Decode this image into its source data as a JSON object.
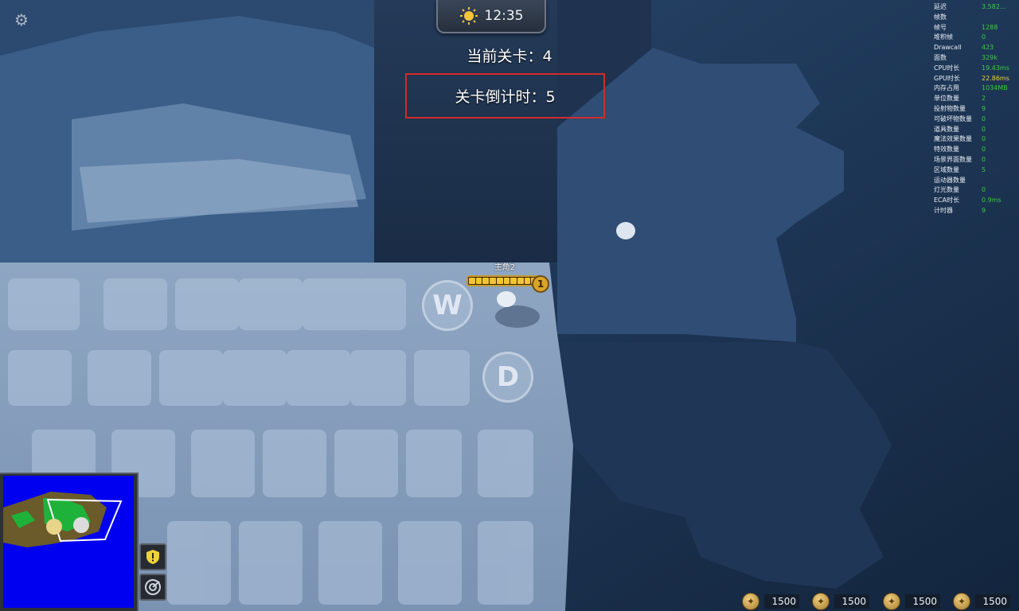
{
  "hud": {
    "clock_time": "12:35",
    "level_label": "当前关卡：4",
    "countdown_label": "关卡倒计时：5"
  },
  "player": {
    "name": "主角2",
    "level_badge": "1",
    "health_fraction": 1.0
  },
  "key_hints": {
    "w": "W",
    "d": "D"
  },
  "stats": [
    {
      "name": "延迟",
      "value": "3.582..."
    },
    {
      "name": "帧数",
      "value": ""
    },
    {
      "name": "帧号",
      "value": "1288"
    },
    {
      "name": "堆积帧",
      "value": "0"
    },
    {
      "name": "Drawcall",
      "value": "423"
    },
    {
      "name": "面数",
      "value": "329k"
    },
    {
      "name": "CPU时长",
      "value": "19.43ms"
    },
    {
      "name": "GPU时长",
      "value": "22.86ms"
    },
    {
      "name": "内存占用",
      "value": "1034MB"
    },
    {
      "name": "单位数量",
      "value": "2"
    },
    {
      "name": "投射物数量",
      "value": "9"
    },
    {
      "name": "可破坏物数量",
      "value": "0"
    },
    {
      "name": "道具数量",
      "value": "0"
    },
    {
      "name": "魔法效果数量",
      "value": "0"
    },
    {
      "name": "特效数量",
      "value": "0"
    },
    {
      "name": "场景界面数量",
      "value": "0"
    },
    {
      "name": "区域数量",
      "value": "5"
    },
    {
      "name": "运动器数量",
      "value": ""
    },
    {
      "name": "灯光数量",
      "value": "0"
    },
    {
      "name": "ECA时长",
      "value": "0.9ms"
    },
    {
      "name": "计时器",
      "value": "9"
    }
  ],
  "resources": [
    {
      "value": "1500"
    },
    {
      "value": "1500"
    },
    {
      "value": "1500"
    },
    {
      "value": "1500"
    }
  ],
  "icons": {
    "settings": "gear-icon",
    "clock": "sun-icon",
    "side_buttons": [
      "alert-shield-icon",
      "radar-icon"
    ],
    "resource": "gold-coin-icon"
  },
  "colors": {
    "countdown_border": "#d22b2b",
    "stat_value": "#35d03a",
    "stat_value_warn": "#f0d23a",
    "minimap_water": "#0000f0",
    "health": "#f2c531"
  }
}
